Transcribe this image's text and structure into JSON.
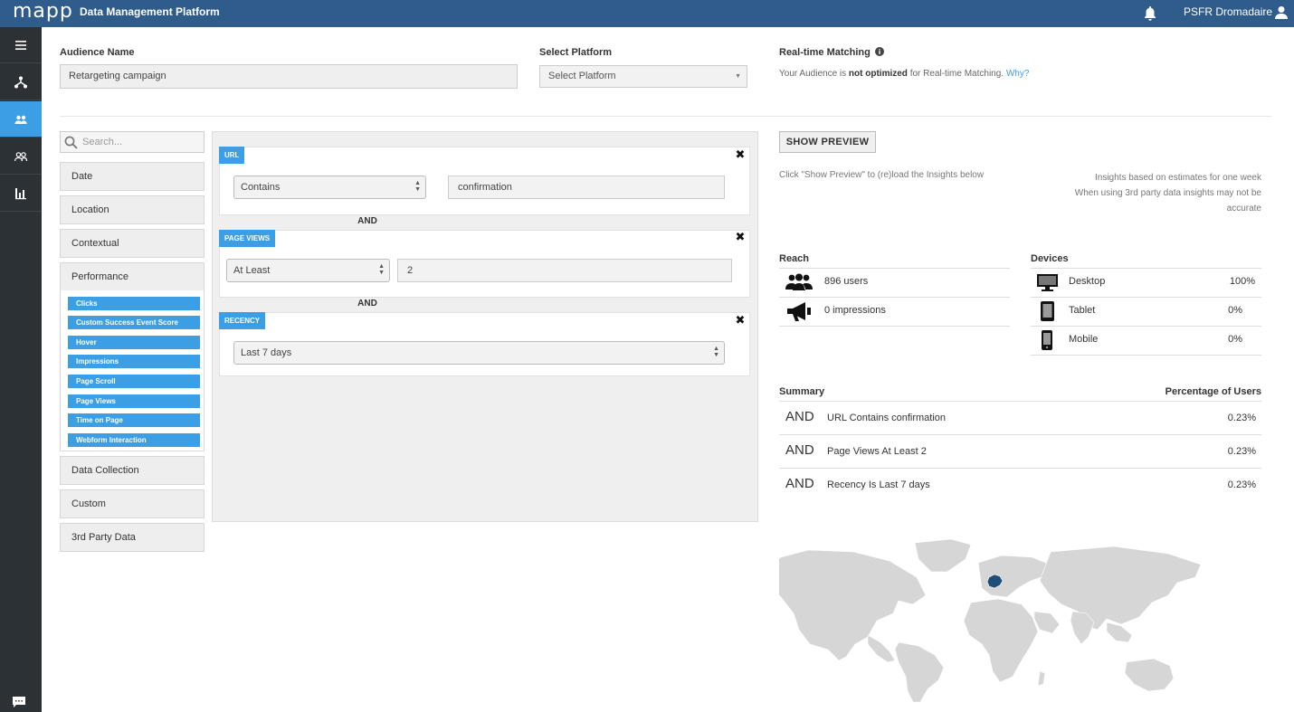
{
  "topbar": {
    "logo": "mapp",
    "app_title": "Data Management Platform",
    "user_name": "PSFR Dromadaire",
    "icons": [
      "bell-icon",
      "user-icon"
    ]
  },
  "sidebar": {
    "items": [
      {
        "icon": "menu-icon",
        "active": false
      },
      {
        "icon": "hierarchy-icon",
        "active": false
      },
      {
        "icon": "audience-icon",
        "active": true
      },
      {
        "icon": "users-group-icon",
        "active": false
      },
      {
        "icon": "bar-chart-icon",
        "active": false
      }
    ],
    "footer_icon": "chat-icon"
  },
  "header": {
    "audience_name_label": "Audience Name",
    "audience_name_value": "Retargeting campaign",
    "platform_label": "Select Platform",
    "platform_value": "Select Platform",
    "realtime_label": "Real-time Matching",
    "realtime_prefix": "Your Audience is ",
    "realtime_bold": "not optimized",
    "realtime_suffix": " for Real-time Matching. ",
    "realtime_link": "Why?"
  },
  "categories": {
    "search_placeholder": "Search...",
    "top": [
      "Date",
      "Location",
      "Contextual"
    ],
    "expanded": {
      "label": "Performance",
      "children": [
        "Clicks",
        "Custom Success Event Score",
        "Hover",
        "Impressions",
        "Page Scroll",
        "Page Views",
        "Time on Page",
        "Webform Interaction"
      ]
    },
    "bottom": [
      "Data Collection",
      "Custom",
      "3rd Party Data"
    ]
  },
  "builder": {
    "connector": "AND",
    "rules": [
      {
        "tag": "URL",
        "operator": "Contains",
        "value": "confirmation"
      },
      {
        "tag": "PAGE VIEWS",
        "operator": "At Least",
        "value": "2"
      },
      {
        "tag": "RECENCY",
        "operator": "Last 7 days"
      }
    ]
  },
  "insights": {
    "preview_button": "SHOW PREVIEW",
    "preview_note": "Click \"Show Preview\" to (re)load the Insights below",
    "estimate_note_1": "Insights based on estimates for one week",
    "estimate_note_2": "When using 3rd party data insights may not be",
    "estimate_note_3": "accurate",
    "reach_label": "Reach",
    "reach": [
      {
        "icon": "users-icon",
        "text": "896 users"
      },
      {
        "icon": "megaphone-icon",
        "text": "0 impressions"
      }
    ],
    "devices_label": "Devices",
    "devices": [
      {
        "icon": "desktop-icon",
        "name": "Desktop",
        "pct": "100%"
      },
      {
        "icon": "tablet-icon",
        "name": "Tablet",
        "pct": "0%"
      },
      {
        "icon": "mobile-icon",
        "name": "Mobile",
        "pct": "0%"
      }
    ],
    "summary_label": "Summary",
    "percentage_label": "Percentage of Users",
    "summary": [
      {
        "op": "AND",
        "text": "URL Contains confirmation",
        "pct": "0.23%"
      },
      {
        "op": "AND",
        "text": "Page Views At Least 2",
        "pct": "0.23%"
      },
      {
        "op": "AND",
        "text": "Recency Is Last 7 days",
        "pct": "0.23%"
      }
    ]
  },
  "colors": {
    "topbar": "#2f5c8a",
    "sidebar": "#2c3136",
    "accent": "#3c9ee5",
    "map_land": "#d6d6d6",
    "map_highlight": "#1f4e79"
  }
}
